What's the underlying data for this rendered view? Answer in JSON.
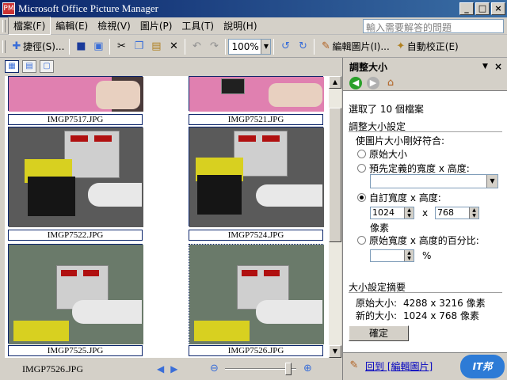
{
  "window": {
    "title": "Microsoft Office Picture Manager",
    "min": "_",
    "max": "□",
    "close": "×",
    "app_icon": "PM"
  },
  "menu": [
    {
      "label": "檔案(F)",
      "active": true
    },
    {
      "label": "編輯(E)"
    },
    {
      "label": "檢視(V)"
    },
    {
      "label": "圖片(P)"
    },
    {
      "label": "工具(T)"
    },
    {
      "label": "說明(H)"
    }
  ],
  "help_placeholder": "輸入需要解答的問題",
  "toolbar": {
    "shortcut_label": "捷徑(S)...",
    "zoom": "100%",
    "edit_picture": "編輯圖片(I)...",
    "auto_correct": "自動校正(E)"
  },
  "thumbnails": [
    {
      "name": "IMGP7517.JPG"
    },
    {
      "name": "IMGP7521.JPG"
    },
    {
      "name": "IMGP7522.JPG"
    },
    {
      "name": "IMGP7524.JPG"
    },
    {
      "name": "IMGP7525.JPG"
    },
    {
      "name": "IMGP7526.JPG"
    }
  ],
  "status": {
    "file": "IMGP7526.JPG"
  },
  "pane": {
    "title": "調整大小",
    "selected": "選取了 10 個檔案",
    "section": "調整大小設定",
    "fit_label": "使圖片大小剛好符合:",
    "opt_original": "原始大小",
    "opt_predefined": "預先定義的寬度 x 高度:",
    "opt_custom": "自訂寬度 x 高度:",
    "width": "1024",
    "x_sep": "x",
    "height": "768",
    "pixels": "像素",
    "opt_percent": "原始寬度 x 高度的百分比:",
    "percent_sign": "%",
    "summary_title": "大小設定摘要",
    "orig_label": "原始大小:",
    "orig_value": "4288 x 3216 像素",
    "new_label": "新的大小:",
    "new_value": "1024 x 768 像素",
    "ok": "確定",
    "back_link": "回到 [編輯圖片]"
  },
  "watermark": "IT邦"
}
